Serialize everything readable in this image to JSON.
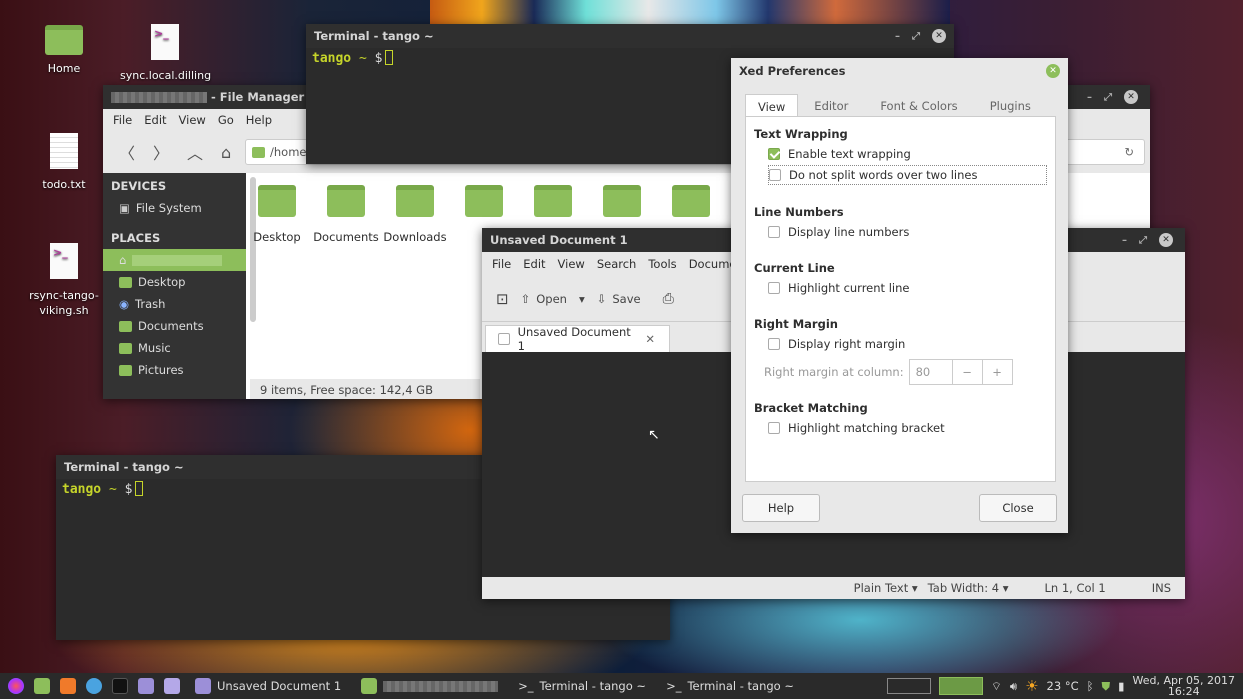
{
  "desktop": {
    "icons": [
      {
        "label": "Home",
        "icon": "home-folder-icon"
      },
      {
        "label": "sync.local.dilling",
        "icon": "script-file-icon"
      },
      {
        "label": "todo.txt",
        "icon": "text-file-icon"
      },
      {
        "label": "rsync-tango-viking.sh",
        "icon": "script-file-icon"
      }
    ]
  },
  "terminal_top": {
    "title": "Terminal - tango ~",
    "host": "tango",
    "path": "~",
    "symbol": "$"
  },
  "terminal_bottom": {
    "title": "Terminal - tango ~",
    "host": "tango",
    "path": "~",
    "symbol": "$"
  },
  "file_manager": {
    "title": "- File Manager",
    "menu": [
      "File",
      "Edit",
      "View",
      "Go",
      "Help"
    ],
    "path": "/home/",
    "devices_header": "DEVICES",
    "places_header": "PLACES",
    "devices": [
      "File System"
    ],
    "places": [
      "",
      "Desktop",
      "Trash",
      "Documents",
      "Music",
      "Pictures"
    ],
    "folders": [
      "Desktop",
      "Documents",
      "Downloads",
      "",
      "",
      "",
      ""
    ],
    "status": "9 items, Free space: 142,4 GB"
  },
  "editor": {
    "title": "Unsaved Document 1",
    "menu": [
      "File",
      "Edit",
      "View",
      "Search",
      "Tools",
      "Documents"
    ],
    "open_label": "Open",
    "save_label": "Save",
    "tab_label": "Unsaved Document 1",
    "status": {
      "lang": "Plain Text",
      "tab_width": "Tab Width:  4",
      "position": "Ln 1, Col 1",
      "mode": "INS"
    }
  },
  "prefs": {
    "title": "Xed Preferences",
    "tabs": [
      "View",
      "Editor",
      "Font & Colors",
      "Plugins"
    ],
    "active_tab": "View",
    "sections": {
      "wrap": "Text Wrapping",
      "wrap_opt1": "Enable text wrapping",
      "wrap_opt2": "Do not split words over two lines",
      "linenum": "Line Numbers",
      "linenum_opt": "Display line numbers",
      "curline": "Current Line",
      "curline_opt": "Highlight current line",
      "margin": "Right Margin",
      "margin_opt": "Display right margin",
      "margin_col_label": "Right margin at column:",
      "margin_col_value": "80",
      "bracket": "Bracket Matching",
      "bracket_opt": "Highlight matching bracket"
    },
    "help": "Help",
    "close": "Close"
  },
  "taskbar": {
    "tasks": [
      "Unsaved Document 1",
      "",
      "Terminal - tango ~",
      "Terminal - tango ~"
    ],
    "weather": "23 °C",
    "date": "Wed, Apr 05, 2017",
    "time": "16:24"
  }
}
